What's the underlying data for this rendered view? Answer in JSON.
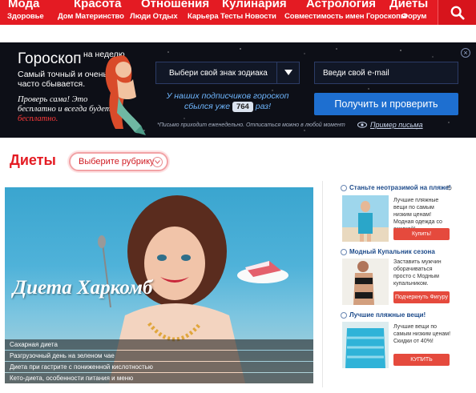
{
  "nav": {
    "columns": [
      {
        "main": "Мода",
        "sub": "Здоровье"
      },
      {
        "main": "Красота",
        "sub": "Дом Материнство"
      },
      {
        "main": "Отношения",
        "sub": "Люди Отдых"
      },
      {
        "main": "Кулинария",
        "sub": "Карьера Тесты Новости"
      },
      {
        "main": "Астрология",
        "sub": "Совместимость имен Гороскопы"
      },
      {
        "main": "Диеты",
        "sub": "Форум"
      }
    ],
    "search_icon": "search-icon"
  },
  "horoscope": {
    "title": "Гороскоп",
    "week": "на неделю",
    "desc": "Самый точный и очень часто сбывается.",
    "check_text": "Проверь сама! Это бесплатно и всегда будет",
    "free_word": "бесплатно.",
    "select_placeholder": "Выбери свой знак зодиака",
    "email_placeholder": "Введи свой e-mail",
    "counter_text_1": "У наших подписчиков гороскоп",
    "counter_text_2": "сбылся уже",
    "counter_num": "764",
    "counter_text_3": "раз!",
    "button": "Получить и проверить",
    "note": "*Письмо приходит еженедельно. Отписаться можно в любой момент",
    "example": "Пример письма"
  },
  "section": {
    "title": "Диеты",
    "rubric": "Выберите рубрику"
  },
  "hero": {
    "headline": "Диета Харкомб",
    "items": [
      "Сахарная диета",
      "Разгрузочный день на зеленом чае",
      "Диета при гастрите с пониженной кислотностью",
      "Кето-диета, особенности питания и меню"
    ]
  },
  "ads": [
    {
      "title": "Станьте неотразимой на пляже!",
      "text": "Лучшие пляжные вещи по самым низким ценам! Модная одежда со скидкой!",
      "button": "Купить!"
    },
    {
      "title": "Модный Купальник сезона",
      "text": "Заставить мужчин оборачиваться просто с Модным купальником.",
      "button": "Подчеркнуть Фигуру"
    },
    {
      "title": "Лучшие пляжные вещи!",
      "text": "Лучшие вещи по самым низким ценам! Скидки от 40%!",
      "button": "КУПИТЬ"
    }
  ],
  "colors": {
    "brand_red": "#e41b23",
    "banner_bg": "#0d0f17",
    "button_blue": "#1e6fd0"
  }
}
